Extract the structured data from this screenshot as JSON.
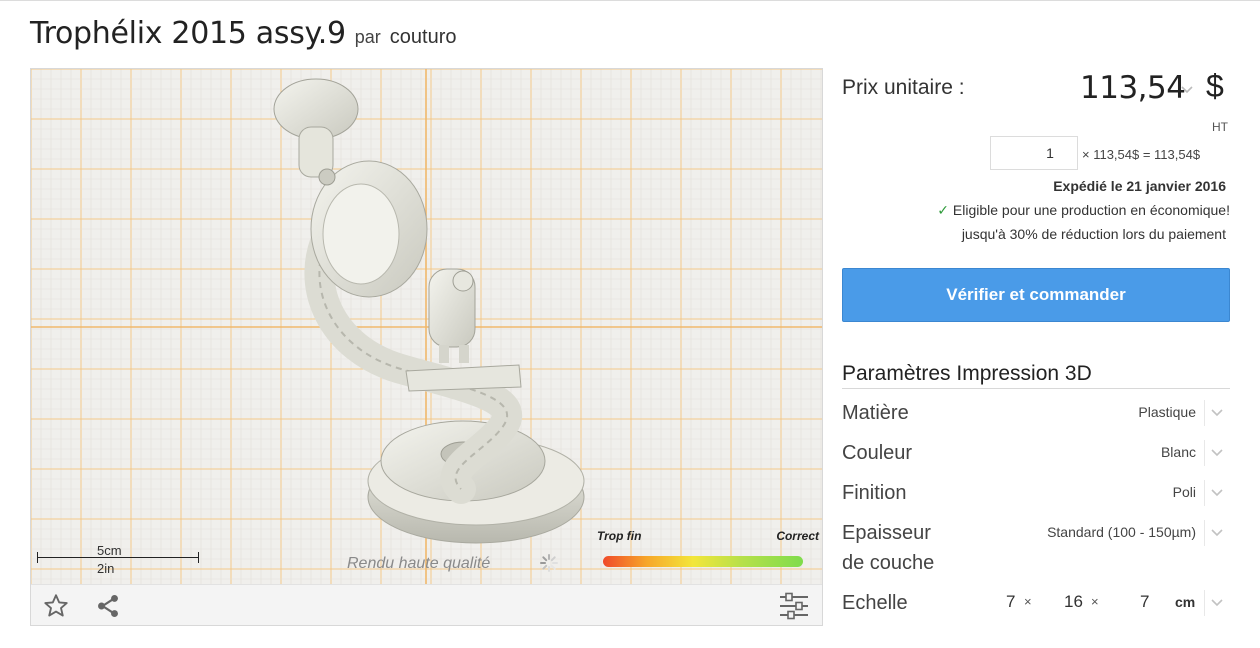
{
  "product": {
    "title": "Trophélix 2015 assy.9",
    "by_label": "par",
    "author": "couturo"
  },
  "viewer": {
    "scale_cm": "5cm",
    "scale_in": "2in",
    "render_label": "Rendu haute qualité",
    "quality_low": "Trop fin",
    "quality_high": "Correct",
    "icons": [
      "star-icon",
      "share-icon",
      "sliders-icon"
    ]
  },
  "pricing": {
    "unit_label": "Prix unitaire :",
    "price": "113,54",
    "currency": "$",
    "tax_note": "HT",
    "quantity": "1",
    "calc": "× 113,54$ = 113,54$",
    "shipping": "Expédié le 21 janvier 2016",
    "eco_line1": "Eligible pour une production en économique!",
    "eco_line2": "jusqu'à 30% de réduction lors du paiement",
    "order_button": "Vérifier et commander"
  },
  "params": {
    "title": "Paramètres Impression 3D",
    "material_label": "Matière",
    "material_value": "Plastique",
    "color_label": "Couleur",
    "color_value": "Blanc",
    "finish_label": "Finition",
    "finish_value": "Poli",
    "layer_label_1": "Epaisseur",
    "layer_label_2": "de couche",
    "layer_value": "Standard (100 - 150µm)",
    "scale_label": "Echelle",
    "dim_x": "7",
    "dim_y": "16",
    "dim_z": "7",
    "times": "×",
    "dim_unit": "cm"
  },
  "colors": {
    "accent": "#4a9be8",
    "check": "#2e9a3a",
    "grid_major": "#f3c98a",
    "grid_minor": "#f6ddb6",
    "viewer_bg": "#f0efec"
  }
}
